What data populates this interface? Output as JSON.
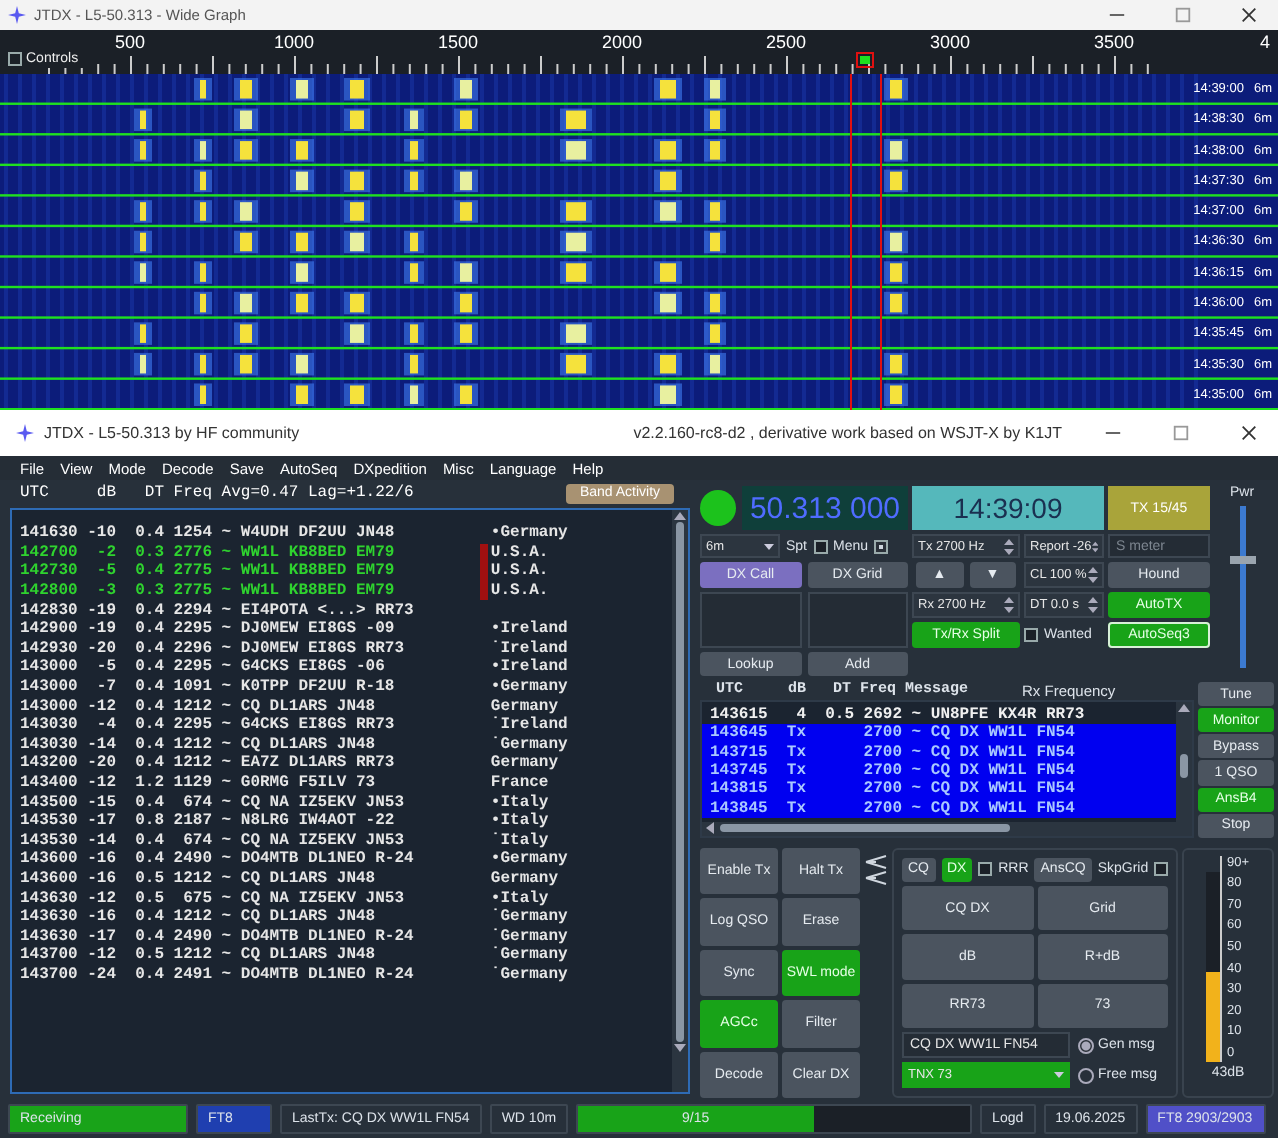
{
  "wide_graph": {
    "title": "JTDX - L5-50.313 - Wide Graph",
    "controls": {
      "label": "Controls",
      "checked": false
    },
    "scale_labels": [
      "500",
      "1000",
      "1500",
      "2000",
      "2500",
      "3000",
      "3500",
      "4"
    ],
    "rows": [
      {
        "time": "14:39:00",
        "band": "6m"
      },
      {
        "time": "14:38:30",
        "band": "6m"
      },
      {
        "time": "14:38:00",
        "band": "6m"
      },
      {
        "time": "14:37:30",
        "band": "6m"
      },
      {
        "time": "14:37:00",
        "band": "6m"
      },
      {
        "time": "14:36:30",
        "band": "6m"
      },
      {
        "time": "14:36:15",
        "band": "6m"
      },
      {
        "time": "14:36:00",
        "band": "6m"
      },
      {
        "time": "14:35:45",
        "band": "6m"
      },
      {
        "time": "14:35:30",
        "band": "6m"
      },
      {
        "time": "14:35:00",
        "band": "6m"
      }
    ]
  },
  "main_window": {
    "title": "JTDX - L5-50.313  by HF community",
    "subtitle": "v2.2.160-rc8-d2 , derivative work based on WSJT-X by K1JT"
  },
  "menu": [
    "File",
    "View",
    "Mode",
    "Decode",
    "Save",
    "AutoSeq",
    "DXpedition",
    "Misc",
    "Language",
    "Help"
  ],
  "band_activity": {
    "header": {
      "utc": "UTC",
      "db": "dB",
      "dt": "DT",
      "freq": "Freq",
      "stats": "Avg=0.47 Lag=+1.22/6"
    },
    "button": "Band Activity",
    "rows": [
      {
        "utc": "141630",
        "db": "-10",
        "dt": "0.4",
        "freq": "1254",
        "message": "~ W4UDH DF2UU JN48",
        "country": "•Germany",
        "color": "#e6e6e6",
        "flagged": false
      },
      {
        "utc": "142700",
        "db": "-2",
        "dt": "0.3",
        "freq": "2776",
        "message": "~ WW1L KB8BED EM79",
        "country": "U.S.A.",
        "color": "#2fd32f",
        "flagged": true
      },
      {
        "utc": "142730",
        "db": "-5",
        "dt": "0.4",
        "freq": "2775",
        "message": "~ WW1L KB8BED EM79",
        "country": "U.S.A.",
        "color": "#2fd32f",
        "flagged": true
      },
      {
        "utc": "142800",
        "db": "-3",
        "dt": "0.3",
        "freq": "2775",
        "message": "~ WW1L KB8BED EM79",
        "country": "U.S.A.",
        "color": "#2fd32f",
        "flagged": true
      },
      {
        "utc": "142830",
        "db": "-19",
        "dt": "0.4",
        "freq": "2294",
        "message": "~ EI4POTA <...> RR73",
        "color": "#e6e6e6",
        "flagged": false
      },
      {
        "utc": "142900",
        "db": "-19",
        "dt": "0.4",
        "freq": "2295",
        "message": "~ DJ0MEW EI8GS -09",
        "country": "•Ireland",
        "color": "#e6e6e6",
        "flagged": false
      },
      {
        "utc": "142930",
        "db": "-20",
        "dt": "0.4",
        "freq": "2296",
        "message": "~ DJ0MEW EI8GS RR73",
        "country": "˙Ireland",
        "color": "#e6e6e6",
        "flagged": false
      },
      {
        "utc": "143000",
        "db": "-5",
        "dt": "0.4",
        "freq": "2295",
        "message": "~ G4CKS EI8GS -06",
        "country": "•Ireland",
        "color": "#e6e6e6",
        "flagged": false
      },
      {
        "utc": "143000",
        "db": "-7",
        "dt": "0.4",
        "freq": "1091",
        "message": "~ K0TPP DF2UU R-18",
        "country": "•Germany",
        "color": "#e6e6e6",
        "flagged": false
      },
      {
        "utc": "143000",
        "db": "-12",
        "dt": "0.4",
        "freq": "1212",
        "message": "~ CQ DL1ARS JN48",
        "country": "Germany",
        "color": "#e6e6e6",
        "flagged": false
      },
      {
        "utc": "143030",
        "db": "-4",
        "dt": "0.4",
        "freq": "2295",
        "message": "~ G4CKS EI8GS RR73",
        "country": "˙Ireland",
        "color": "#e6e6e6",
        "flagged": false
      },
      {
        "utc": "143030",
        "db": "-14",
        "dt": "0.4",
        "freq": "1212",
        "message": "~ CQ DL1ARS JN48",
        "country": "˙Germany",
        "color": "#e6e6e6",
        "flagged": false
      },
      {
        "utc": "143200",
        "db": "-20",
        "dt": "0.4",
        "freq": "1212",
        "message": "~ EA7Z DL1ARS RR73",
        "country": "Germany",
        "color": "#e6e6e6",
        "flagged": false
      },
      {
        "utc": "143400",
        "db": "-12",
        "dt": "1.2",
        "freq": "1129",
        "message": "~ G0RMG F5ILV 73",
        "country": "France",
        "color": "#e6e6e6",
        "flagged": false
      },
      {
        "utc": "143500",
        "db": "-15",
        "dt": "0.4",
        "freq": "674",
        "message": "~ CQ NA IZ5EKV JN53",
        "country": "•Italy",
        "color": "#e6e6e6",
        "flagged": false
      },
      {
        "utc": "143530",
        "db": "-17",
        "dt": "0.8",
        "freq": "2187",
        "message": "~ N8LRG IW4AOT -22",
        "country": "•Italy",
        "color": "#e6e6e6",
        "flagged": false
      },
      {
        "utc": "143530",
        "db": "-14",
        "dt": "0.4",
        "freq": "674",
        "message": "~ CQ NA IZ5EKV JN53",
        "country": "˙Italy",
        "color": "#e6e6e6",
        "flagged": false
      },
      {
        "utc": "143600",
        "db": "-16",
        "dt": "0.4",
        "freq": "2490",
        "message": "~ DO4MTB DL1NEO R-24",
        "country": "•Germany",
        "color": "#e6e6e6",
        "flagged": false
      },
      {
        "utc": "143600",
        "db": "-16",
        "dt": "0.5",
        "freq": "1212",
        "message": "~ CQ DL1ARS JN48",
        "country": "Germany",
        "color": "#e6e6e6",
        "flagged": false
      },
      {
        "utc": "143630",
        "db": "-12",
        "dt": "0.5",
        "freq": "675",
        "message": "~ CQ NA IZ5EKV JN53",
        "country": "•Italy",
        "color": "#e6e6e6",
        "flagged": false
      },
      {
        "utc": "143630",
        "db": "-16",
        "dt": "0.4",
        "freq": "1212",
        "message": "~ CQ DL1ARS JN48",
        "country": "˙Germany",
        "color": "#e6e6e6",
        "flagged": false
      },
      {
        "utc": "143630",
        "db": "-17",
        "dt": "0.4",
        "freq": "2490",
        "message": "~ DO4MTB DL1NEO R-24",
        "country": "˙Germany",
        "color": "#e6e6e6",
        "flagged": false
      },
      {
        "utc": "143700",
        "db": "-12",
        "dt": "0.5",
        "freq": "1212",
        "message": "~ CQ DL1ARS JN48",
        "country": "˙Germany",
        "color": "#e6e6e6",
        "flagged": false
      },
      {
        "utc": "143700",
        "db": "-24",
        "dt": "0.4",
        "freq": "2491",
        "message": "~ DO4MTB DL1NEO R-24",
        "country": "˙Germany",
        "color": "#e6e6e6",
        "flagged": false
      }
    ]
  },
  "radio": {
    "vfo": "50.313 000",
    "clock": "14:39:09",
    "tx_period": "TX 15/45",
    "pwr": {
      "label": "Pwr",
      "level": 0.67
    },
    "band": "6m",
    "spt": {
      "label": "Spt",
      "checked": false
    },
    "menu_toggle": {
      "label": "Menu",
      "checked": true
    },
    "tx_freq": "Tx  2700  Hz",
    "report": "Report -26",
    "s_meter": {
      "placeholder": "S meter"
    },
    "dx_call": "DX Call",
    "dx_grid": "DX Grid",
    "up": "▲",
    "down": "▼",
    "cl": "CL 100 %",
    "hound": {
      "label": "Hound",
      "on": false
    },
    "rx_freq": "Rx  2700  Hz",
    "dt": "DT  0.0 s",
    "autotx": {
      "label": "AutoTX",
      "on": true
    },
    "split": {
      "label": "Tx/Rx Split",
      "on": true
    },
    "wanted": {
      "label": "Wanted",
      "checked": false
    },
    "autoseq": {
      "label": "AutoSeq3",
      "on": true
    },
    "lookup": "Lookup",
    "add": "Add"
  },
  "rx_list": {
    "header": {
      "utc": "UTC",
      "db": "dB",
      "dt": "DT",
      "freq": "Freq",
      "message": "Message",
      "rx": "Rx Frequency"
    },
    "rows": [
      {
        "utc": "143615",
        "db": "4",
        "dt": "0.5",
        "freq": "2692",
        "message": "~ UN8PFE KX4R RR73",
        "selected": false
      },
      {
        "utc": "143645",
        "db": "Tx",
        "freq": "2700",
        "message": "~ CQ DX WW1L FN54",
        "selected": true
      },
      {
        "utc": "143715",
        "db": "Tx",
        "freq": "2700",
        "message": "~ CQ DX WW1L FN54",
        "selected": true
      },
      {
        "utc": "143745",
        "db": "Tx",
        "freq": "2700",
        "message": "~ CQ DX WW1L FN54",
        "selected": true
      },
      {
        "utc": "143815",
        "db": "Tx",
        "freq": "2700",
        "message": "~ CQ DX WW1L FN54",
        "selected": true
      },
      {
        "utc": "143845",
        "db": "Tx",
        "freq": "2700",
        "message": "~ CQ DX WW1L FN54",
        "selected": true
      }
    ]
  },
  "side_buttons": [
    {
      "label": "Tune",
      "on": false
    },
    {
      "label": "Monitor",
      "on": true
    },
    {
      "label": "Bypass",
      "on": false
    },
    {
      "label": "1 QSO",
      "on": false
    },
    {
      "label": "AnsB4",
      "on": true
    },
    {
      "label": "Stop",
      "on": false
    }
  ],
  "control_buttons": [
    {
      "label": "Enable Tx",
      "on": false
    },
    {
      "label": "Halt Tx",
      "on": false
    },
    {
      "label": "Log QSO",
      "on": false
    },
    {
      "label": "Erase",
      "on": false
    },
    {
      "label": "Sync",
      "on": false
    },
    {
      "label": "SWL mode",
      "on": true
    },
    {
      "label": "AGCc",
      "on": true
    },
    {
      "label": "Filter",
      "on": false
    },
    {
      "label": "Decode",
      "on": false
    },
    {
      "label": "Clear DX",
      "on": false
    }
  ],
  "messages": {
    "cq": {
      "label": "CQ",
      "on": false
    },
    "dx": {
      "label": "DX",
      "on": true
    },
    "rrr": {
      "label": "RRR",
      "checked": false
    },
    "anscq": {
      "label": "AnsCQ",
      "on": false
    },
    "skpgrid": {
      "label": "SkpGrid",
      "checked": false
    },
    "buttons": [
      "CQ DX",
      "Grid",
      "dB",
      "R+dB",
      "RR73",
      "73"
    ],
    "gen_field": "CQ DX WW1L FN54",
    "free_select": "TNX 73",
    "radios": [
      {
        "label": "Gen msg",
        "selected": true
      },
      {
        "label": "Free msg",
        "selected": false
      }
    ]
  },
  "meter": {
    "scale": [
      "90+",
      "80",
      "70",
      "60",
      "50",
      "40",
      "30",
      "20",
      "10",
      "0"
    ],
    "level": 0.47,
    "reading": "43dB"
  },
  "status_bar": [
    {
      "text": "Receiving",
      "kind": "ok"
    },
    {
      "text": "FT8",
      "kind": "mode"
    },
    {
      "text": "LastTx: CQ DX WW1L FN54",
      "kind": "plain"
    },
    {
      "text": "WD 10m",
      "kind": "plain"
    },
    {
      "text": "9/15",
      "kind": "progress",
      "level": 0.6
    },
    {
      "text": "Logd",
      "kind": "plain"
    },
    {
      "text": "19.06.2025",
      "kind": "plain"
    },
    {
      "text": "FT8  2903/2903",
      "kind": "purple"
    }
  ]
}
